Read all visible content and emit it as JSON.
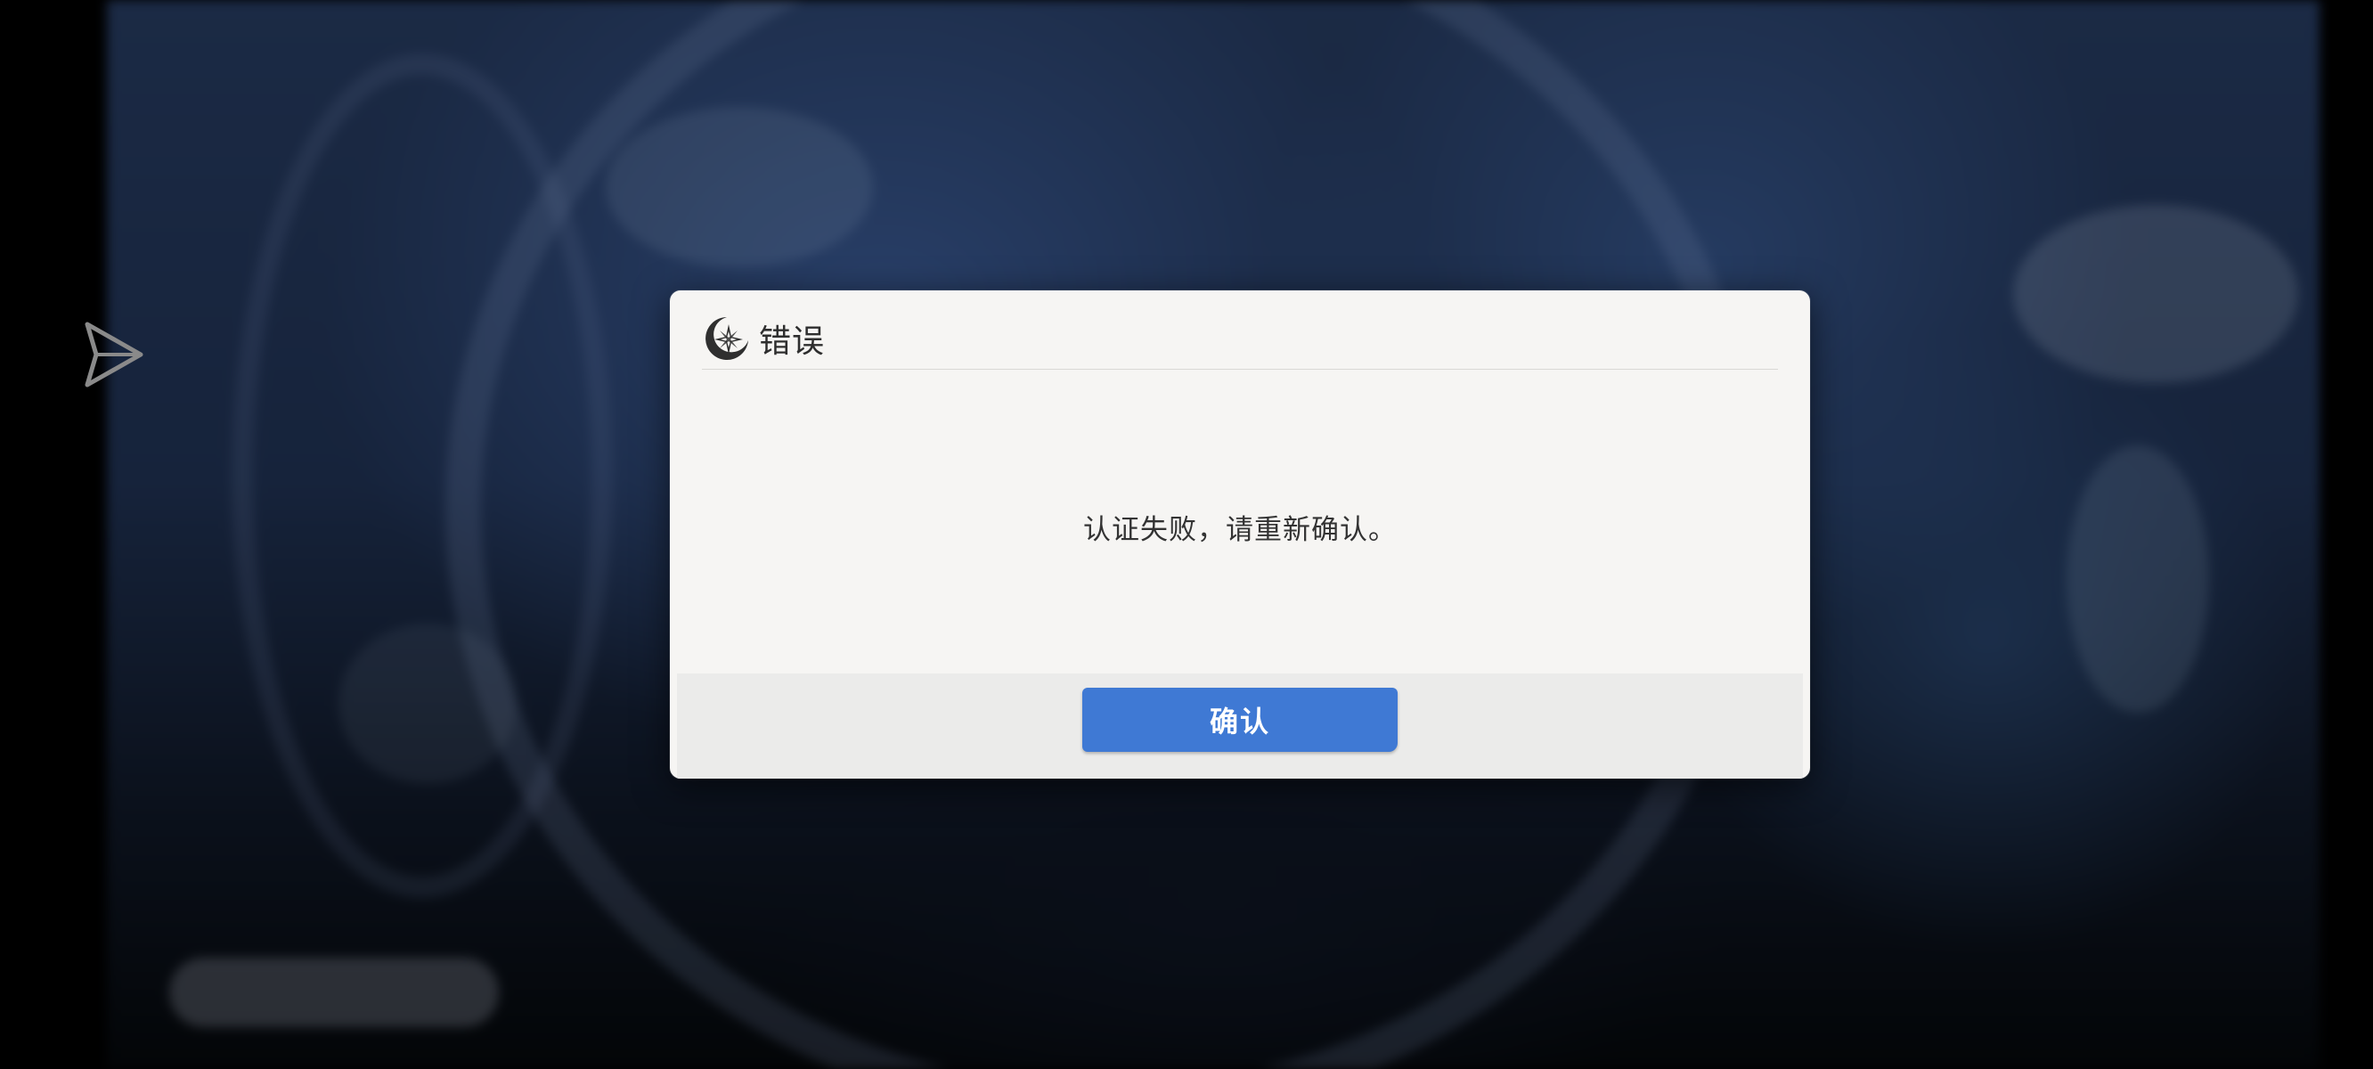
{
  "dialog": {
    "title": "错误",
    "logo_icon": "compass-star-icon",
    "message": "认证失败，请重新确认。",
    "confirm_label": "确认"
  },
  "overlay": {
    "tool_icon": "paper-plane-arrow-icon"
  },
  "colors": {
    "accent": "#3f79d4",
    "dialog_background": "#f6f5f3",
    "footer_background": "#ebebea"
  }
}
